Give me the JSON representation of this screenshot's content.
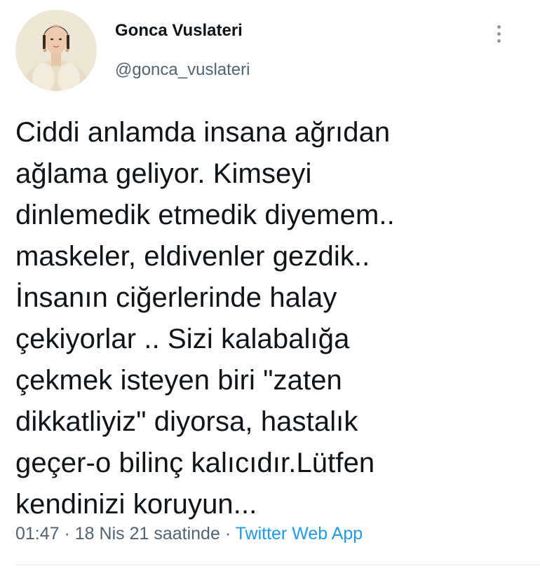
{
  "user": {
    "display_name": "Gonca Vuslateri",
    "handle": "@gonca_vuslateri"
  },
  "tweet": {
    "text": "Ciddi anlamda insana ağrıdan\nağlama geliyor. Kimseyi\ndinlemedik etmedik diyemem..\nmaskeler, eldivenler gezdik..\nİnsanın ciğerlerinde halay\nçekiyorlar .. Sizi kalabalığa\nçekmek isteyen biri \"zaten\ndikkatliyiz\" diyorsa, hastalık\ngeçer-o bilinç kalıcıdır.Lütfen\nkendinizi koruyun..."
  },
  "meta": {
    "time": "01:47",
    "separator": " · ",
    "date": "18 Nis 21 saatinde",
    "source": "Twitter Web App"
  },
  "colors": {
    "text": "#0f1419",
    "secondary": "#536471",
    "link": "#1d9bf0"
  },
  "icons": {
    "more": "more-vertical-icon"
  }
}
